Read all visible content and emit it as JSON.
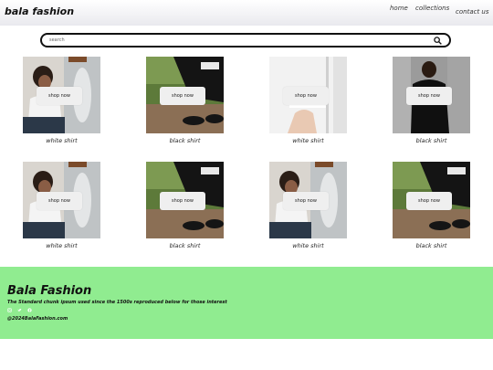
{
  "header": {
    "brand": "bala fashion",
    "nav": [
      {
        "label": "home"
      },
      {
        "label": "collections"
      },
      {
        "label": "contact us"
      }
    ]
  },
  "search": {
    "placeholder": "search",
    "icon": "search-icon"
  },
  "products": [
    {
      "image": "woman-white-shirt",
      "button": "shop now",
      "caption": "white shirt"
    },
    {
      "image": "man-black-shirt-shoes",
      "button": "shop now",
      "caption": "black shirt"
    },
    {
      "image": "hands-white-shirt",
      "button": "shop now",
      "caption": "white shirt"
    },
    {
      "image": "man-back-black-shirt",
      "button": "shop now",
      "caption": "black shirt"
    },
    {
      "image": "woman-white-shirt",
      "button": "shop now",
      "caption": "white shirt"
    },
    {
      "image": "man-black-shirt-shoes",
      "button": "shop now",
      "caption": "black shirt"
    },
    {
      "image": "woman-white-shirt",
      "button": "shop now",
      "caption": "white shirt"
    },
    {
      "image": "man-black-shirt-shoes",
      "button": "shop now",
      "caption": "black shirt"
    }
  ],
  "footer": {
    "title": "Bala Fashion",
    "text": "The Standard chunk ipsum used since the 1500s reproduced below for those interest",
    "social_icons": [
      "instagram-icon",
      "twitter-icon",
      "facebook-icon"
    ],
    "copyright": "@2024BalaFashion.com",
    "background": "#90ec90"
  }
}
